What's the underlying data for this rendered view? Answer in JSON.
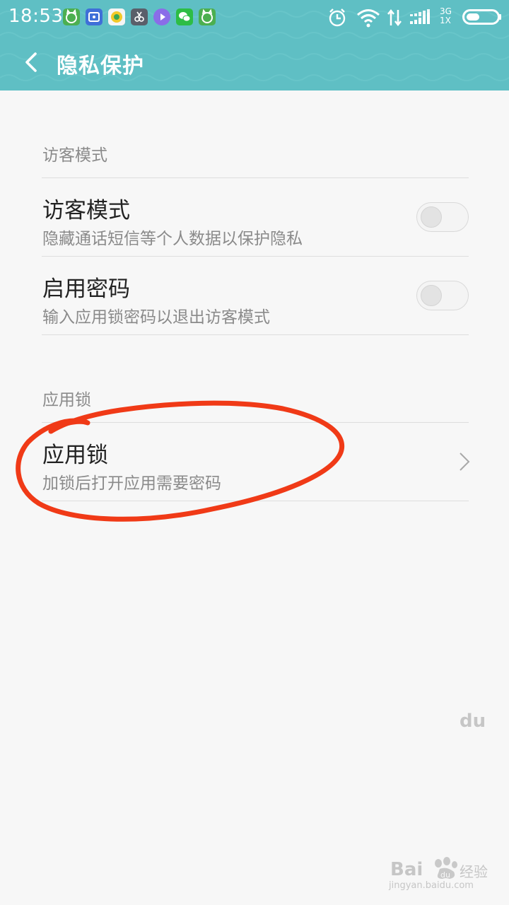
{
  "status_bar": {
    "time": "18:53",
    "network_type": "3G",
    "network_sub": "1X",
    "notification_icons": [
      "cat-app-icon",
      "qr-app-icon",
      "music-app-icon",
      "scissors-app-icon",
      "video-app-icon",
      "wechat-icon",
      "cat-app-icon"
    ],
    "system_icons": [
      "alarm-icon",
      "wifi-icon",
      "data-transfer-icon",
      "signal-icon",
      "battery-icon"
    ]
  },
  "header": {
    "title": "隐私保护",
    "back_icon": "chevron-left-icon",
    "accent_color": "#5fbfc4"
  },
  "sections": [
    {
      "header": "访客模式",
      "rows": [
        {
          "title": "访客模式",
          "subtitle": "隐藏通话短信等个人数据以保护隐私",
          "control": "toggle",
          "on": false
        },
        {
          "title": "启用密码",
          "subtitle": "输入应用锁密码以退出访客模式",
          "control": "toggle",
          "on": false
        }
      ]
    },
    {
      "header": "应用锁",
      "rows": [
        {
          "title": "应用锁",
          "subtitle": "加锁后打开应用需要密码",
          "control": "chevron"
        }
      ]
    }
  ],
  "annotation": {
    "color": "#f03a17"
  },
  "watermark": {
    "logo": "Bai",
    "logo_suffix": "du",
    "site_cn": "经验",
    "url": "jingyan.baidu.com"
  }
}
